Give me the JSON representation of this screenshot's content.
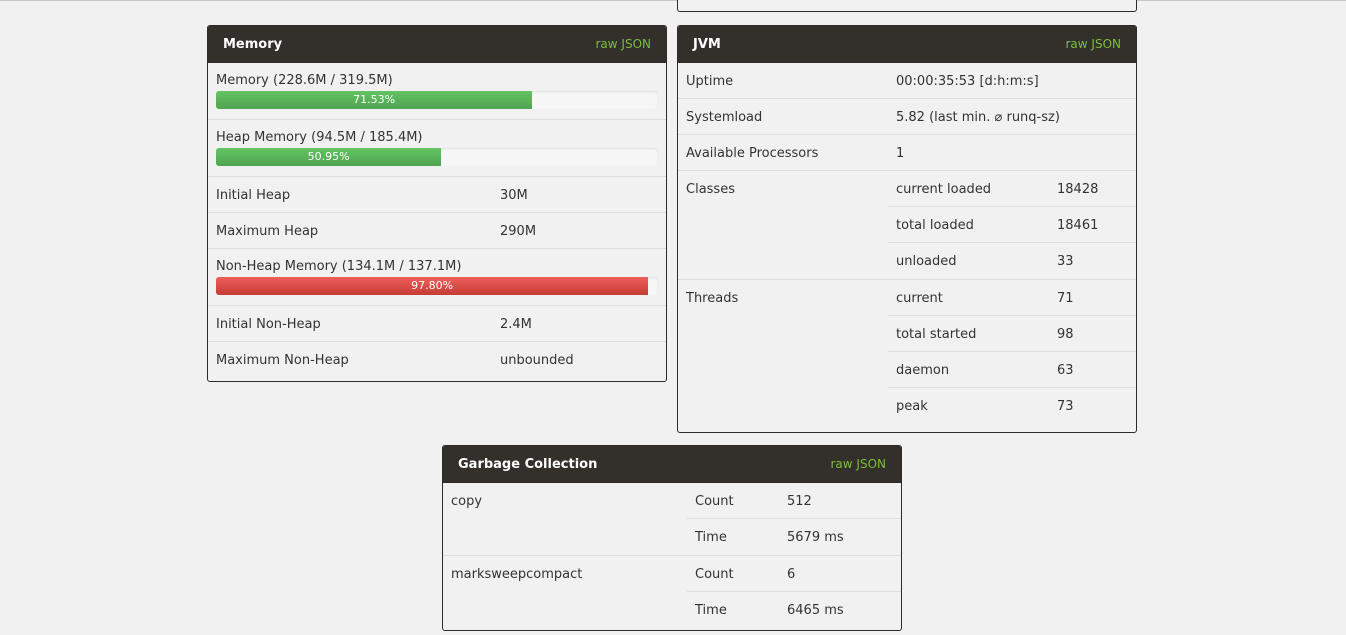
{
  "memory": {
    "title": "Memory",
    "raw": "raw JSON",
    "bars": [
      {
        "label": "Memory (228.6M / 319.5M)",
        "percent_text": "71.53%",
        "percent": 71.53,
        "color": "green"
      },
      {
        "label": "Heap Memory (94.5M / 185.4M)",
        "percent_text": "50.95%",
        "percent": 50.95,
        "color": "green"
      },
      {
        "label": "Non-Heap Memory (134.1M / 137.1M)",
        "percent_text": "97.80%",
        "percent": 97.8,
        "color": "red"
      }
    ],
    "initial_heap": {
      "label": "Initial Heap",
      "value": "30M"
    },
    "maximum_heap": {
      "label": "Maximum Heap",
      "value": "290M"
    },
    "initial_nonheap": {
      "label": "Initial Non-Heap",
      "value": "2.4M"
    },
    "maximum_nonheap": {
      "label": "Maximum Non-Heap",
      "value": "unbounded"
    }
  },
  "jvm": {
    "title": "JVM",
    "raw": "raw JSON",
    "uptime": {
      "label": "Uptime",
      "value": "00:00:35:53 [d:h:m:s]"
    },
    "systemload": {
      "label": "Systemload",
      "value": "5.82 (last min. ⌀ runq-sz)"
    },
    "processors": {
      "label": "Available Processors",
      "value": "1"
    },
    "classes": {
      "label": "Classes",
      "items": [
        {
          "label": "current loaded",
          "value": "18428"
        },
        {
          "label": "total loaded",
          "value": "18461"
        },
        {
          "label": "unloaded",
          "value": "33"
        }
      ]
    },
    "threads": {
      "label": "Threads",
      "items": [
        {
          "label": "current",
          "value": "71"
        },
        {
          "label": "total started",
          "value": "98"
        },
        {
          "label": "daemon",
          "value": "63"
        },
        {
          "label": "peak",
          "value": "73"
        }
      ]
    }
  },
  "gc": {
    "title": "Garbage Collection",
    "raw": "raw JSON",
    "collectors": [
      {
        "name": "copy",
        "count_label": "Count",
        "count": "512",
        "time_label": "Time",
        "time": "5679 ms"
      },
      {
        "name": "marksweepcompact",
        "count_label": "Count",
        "count": "6",
        "time_label": "Time",
        "time": "6465 ms"
      }
    ]
  }
}
